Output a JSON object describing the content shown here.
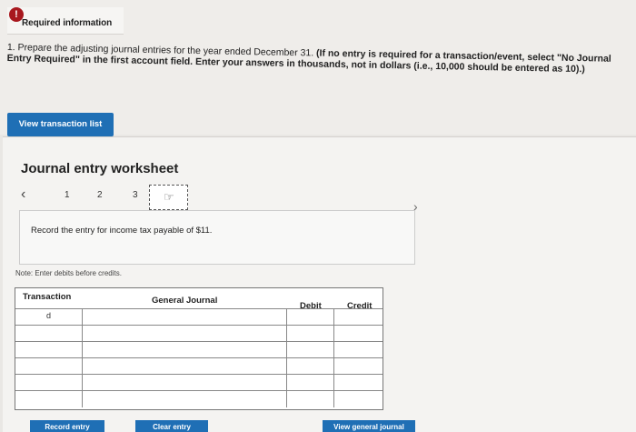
{
  "header": {
    "required_label": "Required information",
    "alert_icon": "!"
  },
  "instructions": {
    "part1": "1. Prepare the adjusting journal entries for the year ended December 31. ",
    "part2": "(If no entry is required for a transaction/event, select \"No Journal Entry Required\" in the first account field. Enter your answers in thousands, not in dollars (i.e., 10,000 should be entered as 10).)"
  },
  "view_transaction_label": "View transaction list",
  "worksheet": {
    "title": "Journal entry worksheet",
    "pages": [
      "1",
      "2",
      "3"
    ],
    "current_page_icon": "hand-pointer-icon",
    "record_text": "Record the entry for income tax payable of $11.",
    "note": "Note: Enter debits before credits."
  },
  "journal": {
    "columns": [
      "Transaction",
      "General Journal",
      "Debit",
      "Credit"
    ],
    "rows": [
      "d",
      "",
      "",
      "",
      "",
      ""
    ]
  },
  "buttons": {
    "record": "Record entry",
    "clear": "Clear entry",
    "view_journal": "View general journal"
  }
}
